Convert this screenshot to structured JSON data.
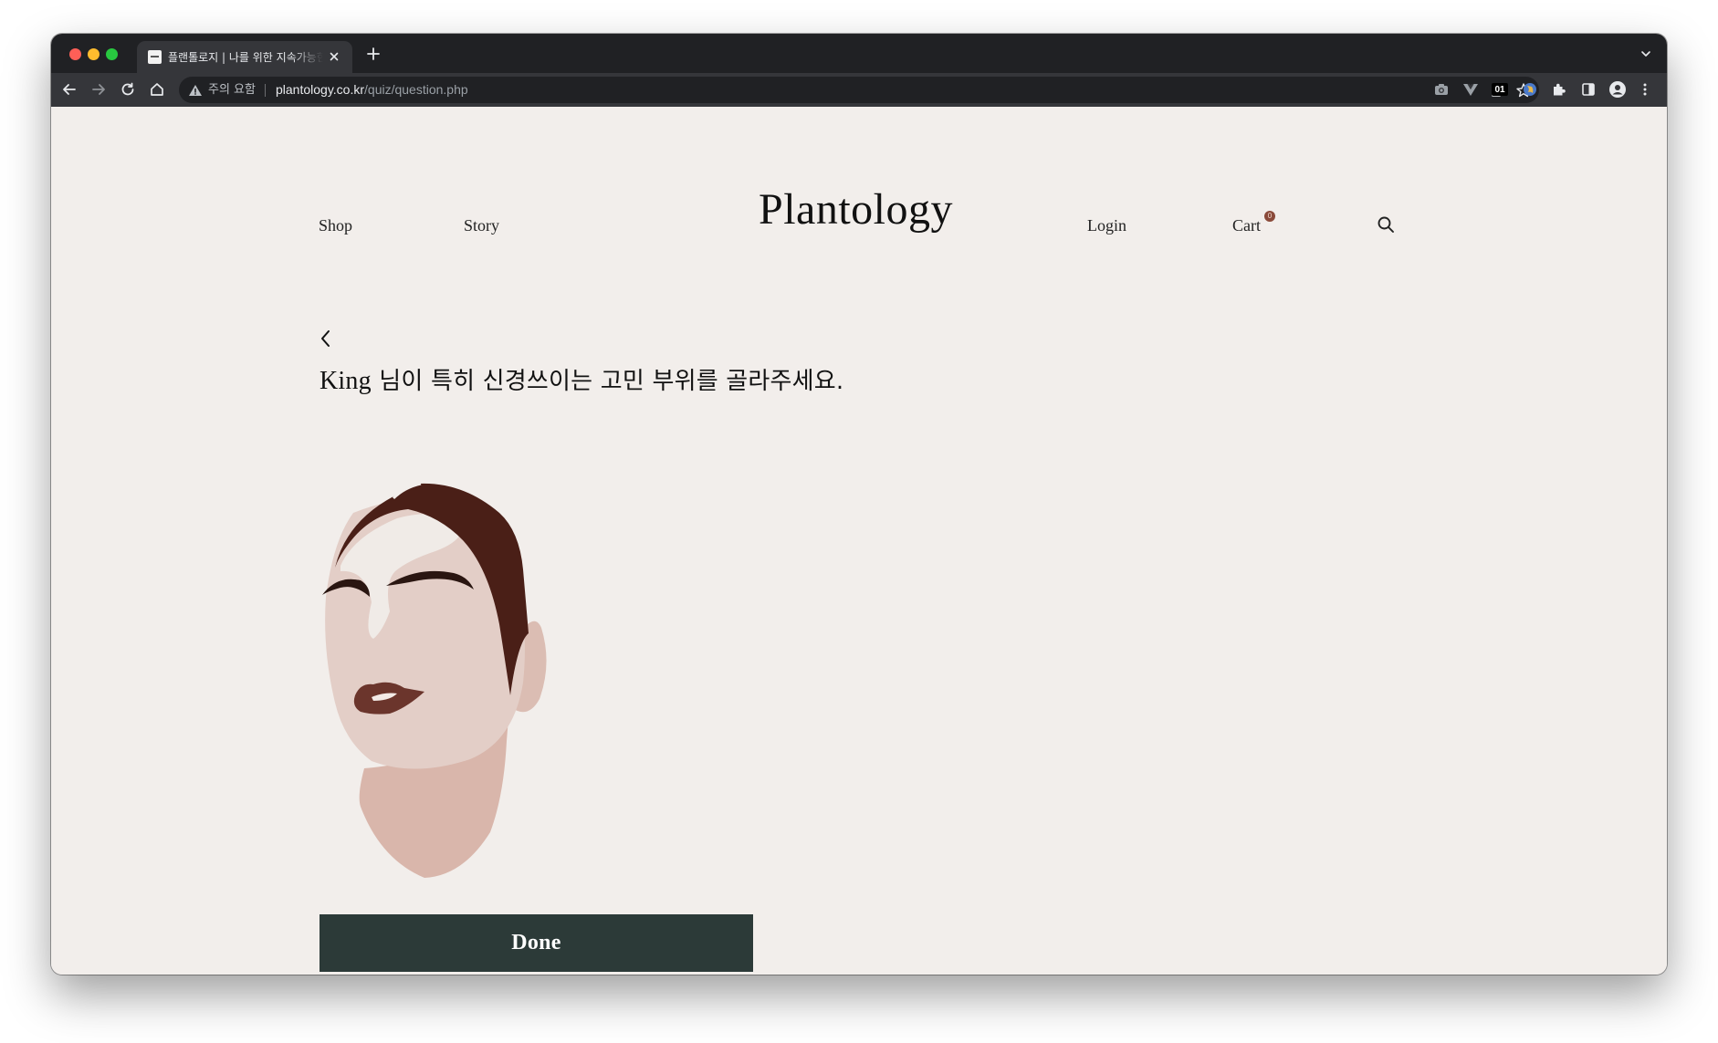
{
  "browser": {
    "tab_title": "플랜톨로지 | 나를 위한 지속가능한 케어",
    "security_label": "주의 요함",
    "url_host": "plantology.co.kr",
    "url_path": "/quiz/question.php",
    "ext_01_label": "01"
  },
  "site": {
    "logo": "Plantology",
    "nav": {
      "shop": "Shop",
      "story": "Story",
      "login": "Login",
      "cart": "Cart",
      "cart_count": "0"
    }
  },
  "quiz": {
    "user_name": "King",
    "question": " 님이 특히 신경쓰이는 고민 부위를 골라주세요.",
    "done_label": "Done"
  },
  "colors": {
    "page_bg": "#f2eeeb",
    "done_button": "#2c3a38",
    "hair": "#4a1f17",
    "lips": "#6b352c",
    "skin": "#e3cec7",
    "neck": "#d9b6ab",
    "cart_badge": "#8a4a3a"
  }
}
